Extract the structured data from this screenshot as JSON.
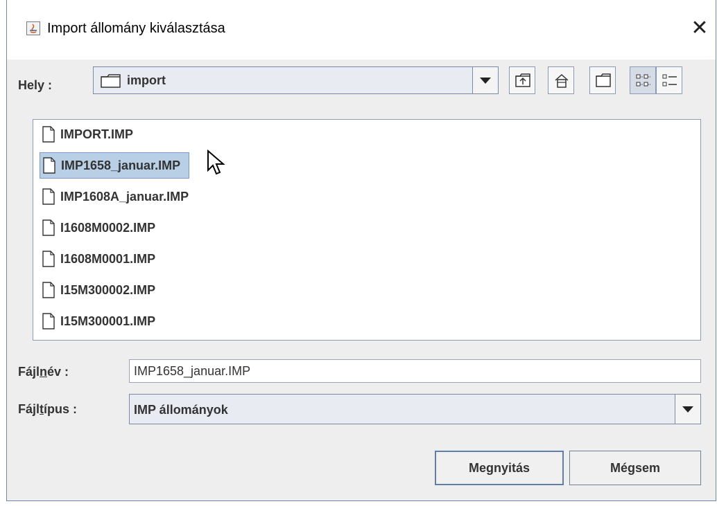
{
  "window": {
    "title": "Import állomány kiválasztása",
    "close_glyph": "✕"
  },
  "location": {
    "label": "Hely :",
    "folder": "import"
  },
  "toolbar": {
    "icons": [
      "up-folder-icon",
      "home-icon",
      "new-folder-icon",
      "list-view-icon",
      "details-view-icon"
    ],
    "active_view": "list"
  },
  "files": [
    {
      "name": "IMPORT.IMP",
      "selected": false
    },
    {
      "name": "IMP1658_januar.IMP",
      "selected": true
    },
    {
      "name": "IMP1608A_januar.IMP",
      "selected": false
    },
    {
      "name": "I1608M0002.IMP",
      "selected": false
    },
    {
      "name": "I1608M0001.IMP",
      "selected": false
    },
    {
      "name": "I15M300002.IMP",
      "selected": false
    },
    {
      "name": "I15M300001.IMP",
      "selected": false
    }
  ],
  "filename": {
    "label_pre": "Fájl",
    "label_mn": "n",
    "label_post": "év :",
    "value": "IMP1658_januar.IMP"
  },
  "filetype": {
    "label_pre": "Fájl",
    "label_mn": "t",
    "label_post": "ípus :",
    "value": "IMP állományok"
  },
  "buttons": {
    "open": "Megnyitás",
    "cancel": "Mégsem"
  },
  "colors": {
    "accent_border": "#7a8aa6",
    "selection": "#b9cfe6"
  }
}
